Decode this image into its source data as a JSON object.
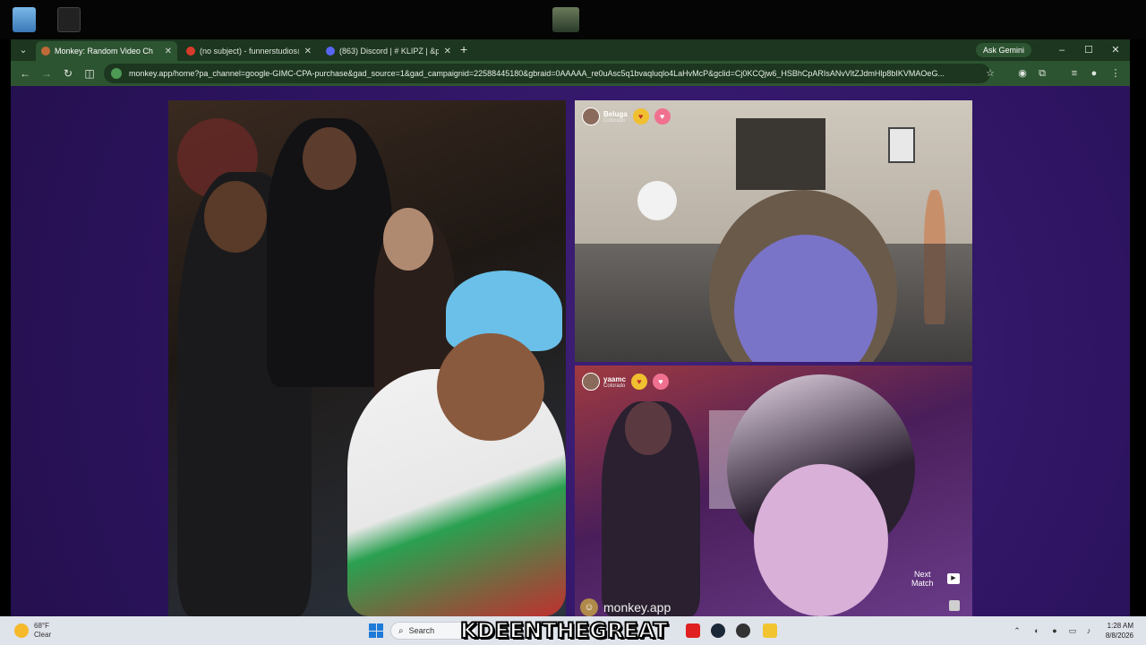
{
  "browser": {
    "tabs": [
      {
        "label": "Monkey: Random Video Ch",
        "active": true,
        "favicon_color": "#c06a3a"
      },
      {
        "label": "(no subject) - funnerstudios@g",
        "active": false,
        "favicon_color": "#d83b2b"
      },
      {
        "label": "(863) Discord | #  KLIPZ | &p",
        "active": false,
        "favicon_color": "#5865f2"
      }
    ],
    "ask_gemini": "Ask Gemini",
    "url": "monkey.app/home?pa_channel=google-GIMC-CPA-purchase&gad_source=1&gad_campaignid=22588445180&gbraid=0AAAAA_re0uAsc5q1bvaqluqlo4LaHvMcP&gclid=Cj0KCQjw6_HSBhCpARIsANvVltZJdmHlp8bIKVMAOeG..."
  },
  "video": {
    "top_right": {
      "user": "Beluga",
      "location": "Colorado"
    },
    "bottom_right": {
      "user": "yaamc",
      "location": "Colorado"
    },
    "next_match_line1": "Next",
    "next_match_line2": "Match",
    "brand": "monkey.app"
  },
  "taskbar": {
    "weather_temp": "68°F",
    "weather_desc": "Clear",
    "search_placeholder": "Search",
    "overlay_text": "KDEENTHEGREAT",
    "time": "1:28 AM",
    "date": "8/8/2026"
  },
  "colors": {
    "page_bg": "#2e1462",
    "browser_chrome": "#2d5431",
    "accent_gold": "#f0c030",
    "accent_pink": "#f07090"
  }
}
